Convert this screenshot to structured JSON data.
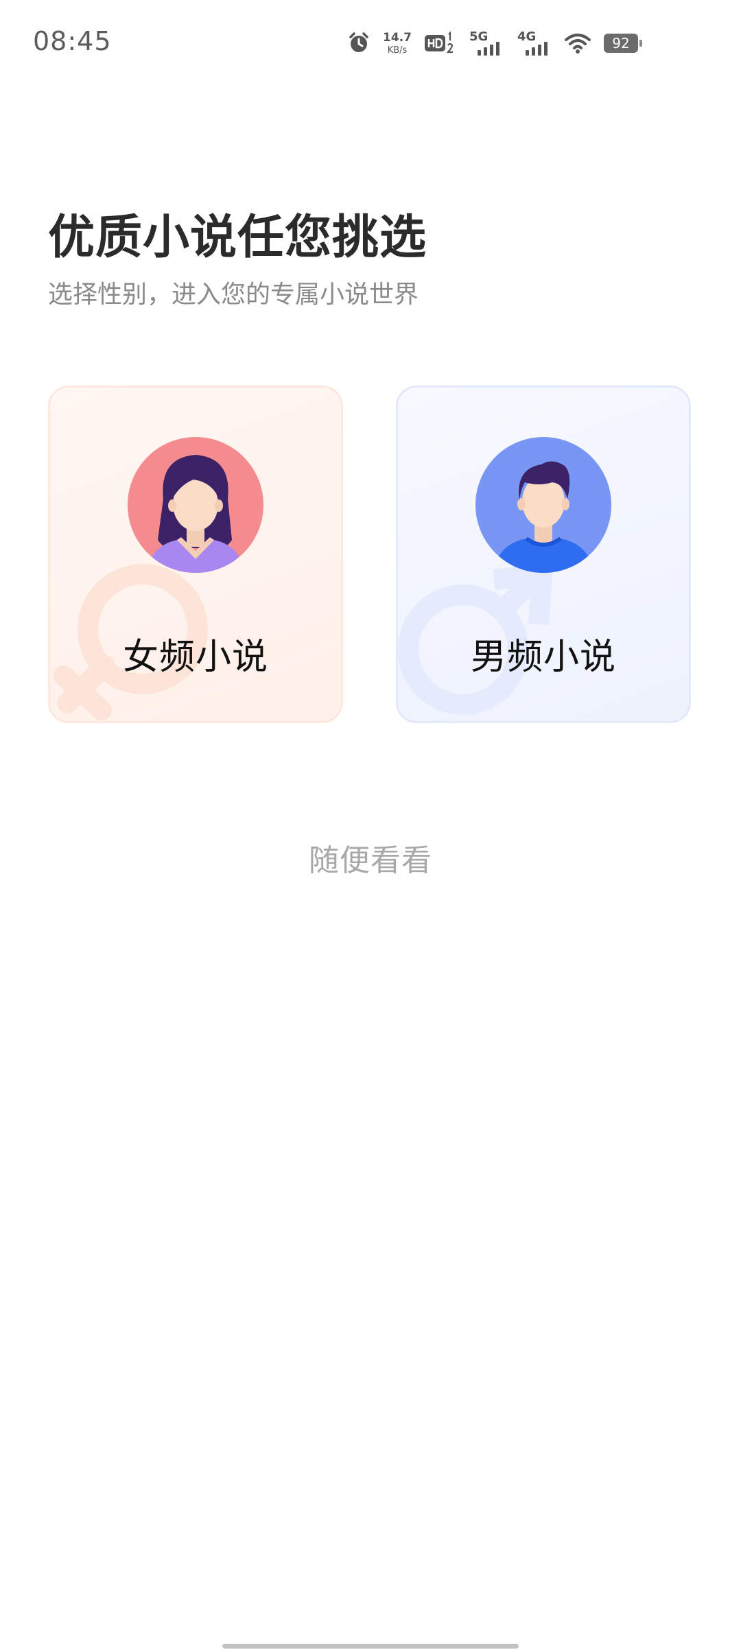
{
  "status_bar": {
    "time": "08:45",
    "net_speed_value": "14.7",
    "net_speed_unit": "KB/s",
    "network_labels": [
      "5G",
      "4G"
    ],
    "battery": "92",
    "icons": [
      "alarm-icon",
      "hd-icon",
      "signal-5g-icon",
      "signal-4g-icon",
      "wifi-icon",
      "battery-icon"
    ]
  },
  "header": {
    "title": "优质小说任您挑选",
    "subtitle": "选择性别，进入您的专属小说世界"
  },
  "cards": {
    "female": {
      "label": "女频小说",
      "icon": "female-avatar-icon",
      "watermark_icon": "female-symbol-icon",
      "accent": "#f48b8f"
    },
    "male": {
      "label": "男频小说",
      "icon": "male-avatar-icon",
      "watermark_icon": "male-symbol-icon",
      "accent": "#7a96f5"
    }
  },
  "skip": {
    "label": "随便看看"
  }
}
